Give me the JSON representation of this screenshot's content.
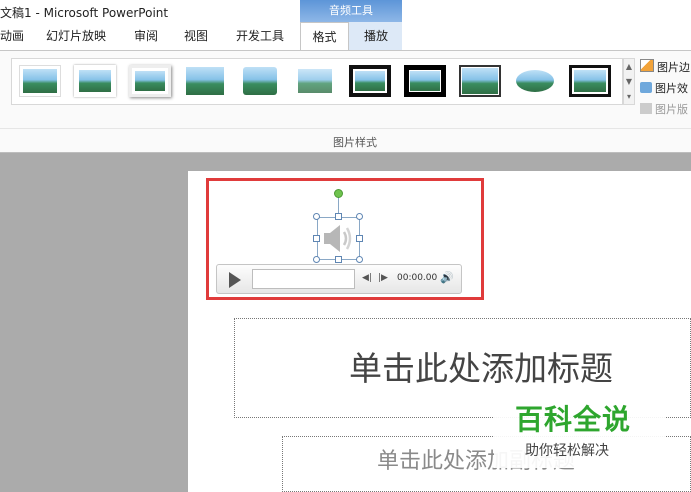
{
  "window": {
    "title": "文稿1 - Microsoft PowerPoint"
  },
  "ribbon": {
    "context_group": "音频工具",
    "tabs": [
      {
        "label": "动画"
      },
      {
        "label": "幻灯片放映"
      },
      {
        "label": "审阅"
      },
      {
        "label": "视图"
      },
      {
        "label": "开发工具"
      },
      {
        "label": "格式",
        "active": true
      },
      {
        "label": "播放"
      }
    ],
    "gallery_label": "图片样式",
    "right_commands": [
      {
        "label": "图片边",
        "icon": "border-icon"
      },
      {
        "label": "图片效",
        "icon": "effects-icon"
      },
      {
        "label": "图片版",
        "icon": "layout-icon",
        "disabled": true
      }
    ]
  },
  "player": {
    "time": "00:00.00"
  },
  "slide": {
    "title_placeholder": "单击此处添加标题",
    "subtitle_placeholder": "单击此处添加副标题"
  },
  "watermark": {
    "main": "百科全说",
    "sub": "助你轻松解决"
  },
  "colors": {
    "highlight": "#e03b3b",
    "context_tab": "#5d95d8",
    "watermark": "#2ea62e"
  }
}
